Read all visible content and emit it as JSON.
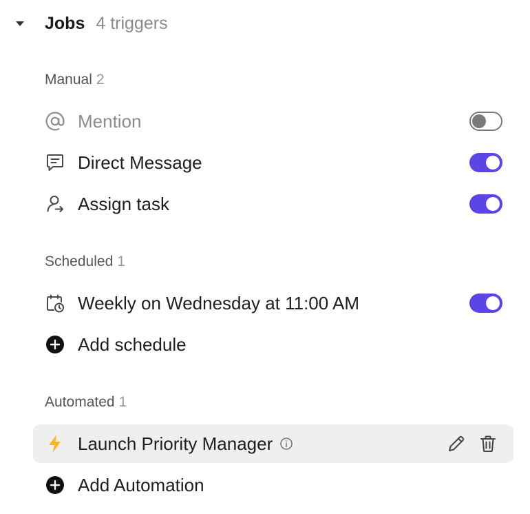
{
  "header": {
    "title": "Jobs",
    "count": "4 triggers"
  },
  "sections": {
    "manual": {
      "title": "Manual",
      "count": "2"
    },
    "scheduled": {
      "title": "Scheduled",
      "count": "1"
    },
    "automated": {
      "title": "Automated",
      "count": "1"
    }
  },
  "manual_items": [
    {
      "label": "Mention",
      "icon": "at-icon",
      "enabled": false
    },
    {
      "label": "Direct Message",
      "icon": "message-icon",
      "enabled": true
    },
    {
      "label": "Assign task",
      "icon": "assign-task-icon",
      "enabled": true
    }
  ],
  "scheduled_items": [
    {
      "label": "Weekly on Wednesday at 11:00 AM",
      "icon": "calendar-clock-icon",
      "enabled": true
    }
  ],
  "add_schedule": {
    "label": "Add schedule"
  },
  "automated_items": [
    {
      "label": "Launch Priority Manager",
      "icon": "lightning-icon"
    }
  ],
  "add_automation": {
    "label": "Add Automation"
  },
  "colors": {
    "accent": "#5b45e6",
    "lightning": "#f5b820",
    "muted": "#8c8c8c"
  }
}
